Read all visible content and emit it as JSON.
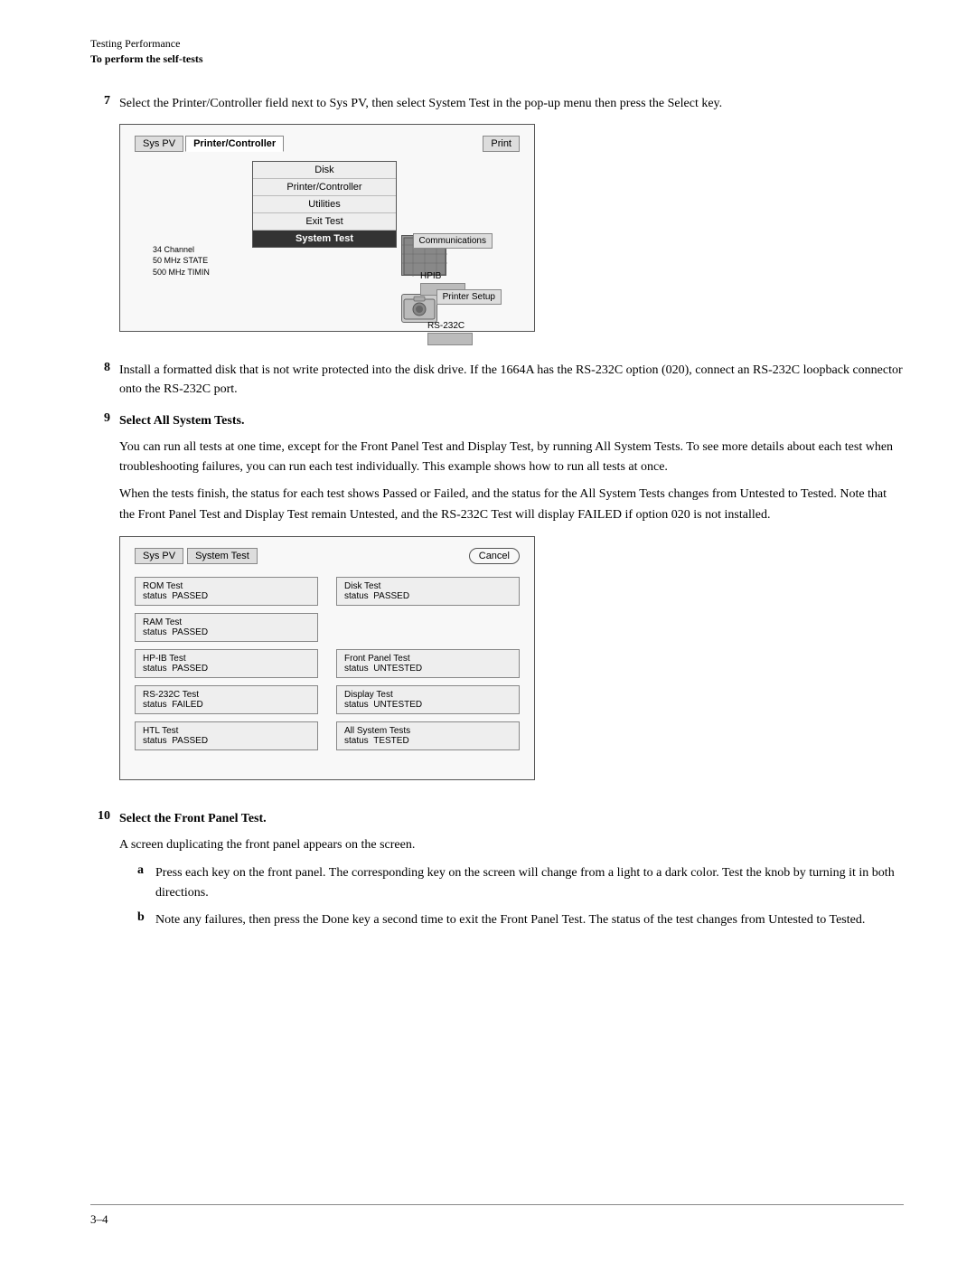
{
  "header": {
    "line1": "Testing Performance",
    "line2": "To perform the self-tests"
  },
  "steps": [
    {
      "number": "7",
      "text": "Select the Printer/Controller field next to Sys PV, then select System Test in the pop-up menu then press the Select key."
    },
    {
      "number": "8",
      "text": "Install a formatted disk that is not write protected into the disk drive.  If the 1664A has the RS-232C option (020), connect an RS-232C loopback connector onto the RS-232C port."
    },
    {
      "number": "9",
      "text": "Select All System Tests.",
      "sub1": "You can run all tests at one time, except for the Front Panel Test and Display Test, by running All System Tests. To see more details about each test when troubleshooting failures, you can run each test individually.  This example shows how to run all tests at once.",
      "sub2": "When the tests finish, the status for each test shows Passed or Failed, and the status for the All System Tests changes from Untested to Tested.  Note that the Front Panel Test and Display Test remain Untested, and the RS-232C Test will display FAILED if option 020 is not installed."
    },
    {
      "number": "10",
      "text": "Select the Front Panel Test.",
      "sub1": "A screen duplicating the front panel appears on the screen.",
      "suba": "Press each key on the front panel.  The corresponding key on the screen will change from a light to a dark color. Test the knob by turning it in both directions.",
      "subb": "Note any failures, then press the Done key a second time to exit the Front Panel Test.  The status of the test changes from Untested to Tested."
    }
  ],
  "diag1": {
    "tabs": [
      "Sys PV",
      "Printer/Controller"
    ],
    "print_btn": "Print",
    "menu_items": [
      "Disk",
      "Printer/Controller",
      "Utilities",
      "Exit Test",
      "System Test"
    ],
    "side_lines": [
      "34  Channel",
      "50 MHz STATE",
      "500 MHz TIMIN"
    ],
    "comm": "Communications",
    "hpib": "HPIB",
    "printer_setup": "Printer Setup",
    "rs232c": "RS-232C"
  },
  "diag2": {
    "tabs": [
      "Sys PV",
      "System Test"
    ],
    "cancel_btn": "Cancel",
    "tests": [
      {
        "name": "ROM Test",
        "status": "PASSED"
      },
      {
        "name": "Disk Test",
        "status": "PASSED"
      },
      {
        "name": "RAM Test",
        "status": "PASSED"
      },
      {
        "name": "",
        "status": ""
      },
      {
        "name": "HP-IB Test",
        "status": "PASSED"
      },
      {
        "name": "Front Panel Test",
        "status": "UNTESTED"
      },
      {
        "name": "RS-232C Test",
        "status": "FAILED"
      },
      {
        "name": "Display Test",
        "status": "UNTESTED"
      },
      {
        "name": "HTL Test",
        "status": "PASSED"
      },
      {
        "name": "All System Tests",
        "status": "TESTED"
      }
    ]
  },
  "footer": {
    "page": "3–4"
  }
}
